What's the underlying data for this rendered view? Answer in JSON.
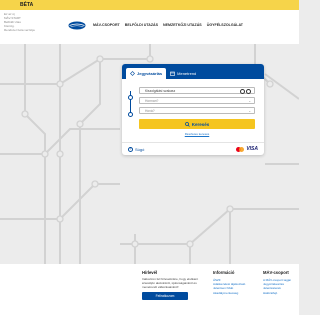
{
  "beta_label": "BÉTA",
  "header": {
    "notice_lines": [
      "Ez az új",
      "MÁV-START",
      "Belföldi Utas",
      "Kiszolg.",
      "Rendszer béta verziója"
    ],
    "nav": [
      "MÁV-CSOPORT",
      "BELFÖLDI UTAZÁS",
      "NEMZETKÖZI UTAZÁS",
      "ÜGYFÉLSZOLGÁLAT"
    ]
  },
  "booking": {
    "tabs": {
      "planner": "Jegyvásárlás",
      "timetable": "Menetrend"
    },
    "ticket_type": "Kiszolgálási szakasz",
    "from_placeholder": "Honnan?",
    "to_placeholder": "Hová?",
    "search_label": "Keresés",
    "extra_link": "Részletes keresés",
    "help_label": "Súgó",
    "card_brand": "VISA"
  },
  "footer": {
    "newsletter": {
      "title": "Hírlevél",
      "text": "Iratkozzon fel hírlevelünkre, hogy elsőként értesüljön akcióinkról, újdonságainkról és menetrendi változásainkról!",
      "button": "Feliratkozom"
    },
    "info": {
      "title": "Információ",
      "links": [
        "ÁSZF",
        "Adatkezelési tájékoztató",
        "Jelentsen hibát",
        "Akadálymentesség"
      ]
    },
    "group": {
      "title": "MÁV-csoport",
      "links": [
        "A MÁV-csoport tagjai",
        "Jegyértékesítés",
        "Jelentésterek",
        "Hálózatfejl."
      ]
    }
  },
  "colors": {
    "primary": "#004b9e",
    "accent": "#f5c51f",
    "beta": "#f6d44a",
    "map_line": "#d2d2d2"
  }
}
